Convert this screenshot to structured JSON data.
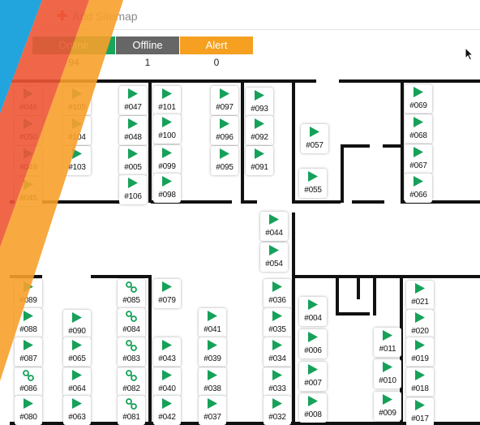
{
  "toolbar": {
    "add_sitemap_label": "Add Sitemap"
  },
  "status": {
    "online": {
      "label": "Online",
      "count": "94",
      "color": "#1aa55c"
    },
    "offline": {
      "label": "Offline",
      "count": "1",
      "color": "#666666"
    },
    "alert": {
      "label": "Alert",
      "count": "0",
      "color": "#f5a020"
    }
  },
  "ribbon_colors": [
    "#22a4dc",
    "#ee5535",
    "#f7a02a"
  ],
  "cameras": [
    {
      "id": "#046",
      "state": "online"
    },
    {
      "id": "#105",
      "state": "online"
    },
    {
      "id": "#047",
      "state": "online"
    },
    {
      "id": "#101",
      "state": "online"
    },
    {
      "id": "#097",
      "state": "online"
    },
    {
      "id": "#093",
      "state": "online"
    },
    {
      "id": "#069",
      "state": "online"
    },
    {
      "id": "#050",
      "state": "online"
    },
    {
      "id": "#104",
      "state": "online"
    },
    {
      "id": "#048",
      "state": "online"
    },
    {
      "id": "#100",
      "state": "online"
    },
    {
      "id": "#096",
      "state": "online"
    },
    {
      "id": "#092",
      "state": "online"
    },
    {
      "id": "#057",
      "state": "online"
    },
    {
      "id": "#068",
      "state": "online"
    },
    {
      "id": "#049",
      "state": "online"
    },
    {
      "id": "#103",
      "state": "online"
    },
    {
      "id": "#005",
      "state": "online"
    },
    {
      "id": "#099",
      "state": "online"
    },
    {
      "id": "#095",
      "state": "online"
    },
    {
      "id": "#091",
      "state": "online"
    },
    {
      "id": "#067",
      "state": "online"
    },
    {
      "id": "#045",
      "state": "online"
    },
    {
      "id": "#106",
      "state": "online"
    },
    {
      "id": "#098",
      "state": "online"
    },
    {
      "id": "#055",
      "state": "online"
    },
    {
      "id": "#066",
      "state": "online"
    },
    {
      "id": "#044",
      "state": "online"
    },
    {
      "id": "#054",
      "state": "online"
    },
    {
      "id": "#089",
      "state": "online"
    },
    {
      "id": "#085",
      "state": "linked"
    },
    {
      "id": "#079",
      "state": "online"
    },
    {
      "id": "#036",
      "state": "online"
    },
    {
      "id": "#021",
      "state": "online"
    },
    {
      "id": "#088",
      "state": "online"
    },
    {
      "id": "#090",
      "state": "online"
    },
    {
      "id": "#084",
      "state": "linked"
    },
    {
      "id": "#041",
      "state": "online"
    },
    {
      "id": "#035",
      "state": "online"
    },
    {
      "id": "#004",
      "state": "online"
    },
    {
      "id": "#020",
      "state": "online"
    },
    {
      "id": "#087",
      "state": "online"
    },
    {
      "id": "#065",
      "state": "online"
    },
    {
      "id": "#083",
      "state": "linked"
    },
    {
      "id": "#043",
      "state": "online"
    },
    {
      "id": "#039",
      "state": "online"
    },
    {
      "id": "#034",
      "state": "online"
    },
    {
      "id": "#006",
      "state": "online"
    },
    {
      "id": "#011",
      "state": "online"
    },
    {
      "id": "#019",
      "state": "online"
    },
    {
      "id": "#086",
      "state": "linked"
    },
    {
      "id": "#064",
      "state": "online"
    },
    {
      "id": "#082",
      "state": "linked"
    },
    {
      "id": "#040",
      "state": "online"
    },
    {
      "id": "#038",
      "state": "online"
    },
    {
      "id": "#033",
      "state": "online"
    },
    {
      "id": "#007",
      "state": "online"
    },
    {
      "id": "#010",
      "state": "online"
    },
    {
      "id": "#018",
      "state": "online"
    },
    {
      "id": "#080",
      "state": "online"
    },
    {
      "id": "#063",
      "state": "online"
    },
    {
      "id": "#081",
      "state": "linked"
    },
    {
      "id": "#042",
      "state": "online"
    },
    {
      "id": "#037",
      "state": "online"
    },
    {
      "id": "#032",
      "state": "online"
    },
    {
      "id": "#008",
      "state": "online"
    },
    {
      "id": "#009",
      "state": "online"
    },
    {
      "id": "#017",
      "state": "online"
    }
  ]
}
